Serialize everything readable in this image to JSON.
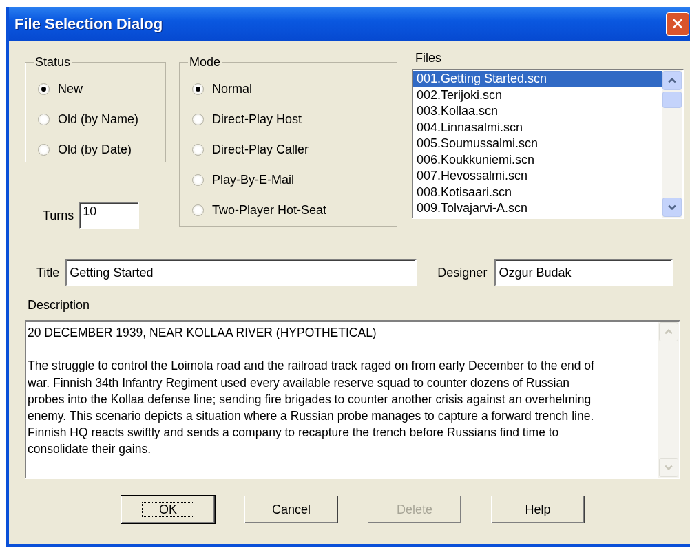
{
  "window": {
    "title": "File Selection Dialog",
    "close": "✕"
  },
  "status": {
    "label": "Status",
    "options": [
      {
        "label": "New",
        "selected": true
      },
      {
        "label": "Old (by Name)",
        "selected": false
      },
      {
        "label": "Old (by Date)",
        "selected": false
      }
    ]
  },
  "mode": {
    "label": "Mode",
    "options": [
      {
        "label": "Normal",
        "selected": true
      },
      {
        "label": "Direct-Play Host",
        "selected": false
      },
      {
        "label": "Direct-Play Caller",
        "selected": false
      },
      {
        "label": "Play-By-E-Mail",
        "selected": false
      },
      {
        "label": "Two-Player Hot-Seat",
        "selected": false
      }
    ]
  },
  "turns": {
    "label": "Turns",
    "value": "10"
  },
  "files": {
    "label": "Files",
    "items": [
      {
        "label": "001.Getting Started.scn",
        "selected": true
      },
      {
        "label": "002.Terijoki.scn",
        "selected": false
      },
      {
        "label": "003.Kollaa.scn",
        "selected": false
      },
      {
        "label": "004.Linnasalmi.scn",
        "selected": false
      },
      {
        "label": "005.Soumussalmi.scn",
        "selected": false
      },
      {
        "label": "006.Koukkuniemi.scn",
        "selected": false
      },
      {
        "label": "007.Hevossalmi.scn",
        "selected": false
      },
      {
        "label": "008.Kotisaari.scn",
        "selected": false
      },
      {
        "label": "009.Tolvajarvi-A.scn",
        "selected": false
      }
    ]
  },
  "title": {
    "label": "Title",
    "value": "Getting Started"
  },
  "designer": {
    "label": "Designer",
    "value": "Ozgur Budak"
  },
  "description": {
    "label": "Description",
    "heading": "20 DECEMBER 1939, NEAR KOLLAA RIVER (HYPOTHETICAL)",
    "lines": [
      "The struggle to control the Loimola road and the railroad track raged on from early December to the end of",
      "war. Finnish 34th Infantry Regiment used every available reserve squad to counter dozens of Russian",
      "probes into the Kollaa defense line; sending fire brigades to counter another crisis against an overhelming",
      "enemy. This scenario depicts a situation where a Russian probe manages to capture a forward trench line.",
      "Finnish HQ reacts swiftly and sends a company to recapture the trench before Russians find time to",
      "consolidate their gains."
    ]
  },
  "buttons": [
    {
      "label": "OK",
      "default": true,
      "disabled": false
    },
    {
      "label": "Cancel",
      "default": false,
      "disabled": false
    },
    {
      "label": "Delete",
      "default": false,
      "disabled": true
    },
    {
      "label": "Help",
      "default": false,
      "disabled": false
    }
  ]
}
